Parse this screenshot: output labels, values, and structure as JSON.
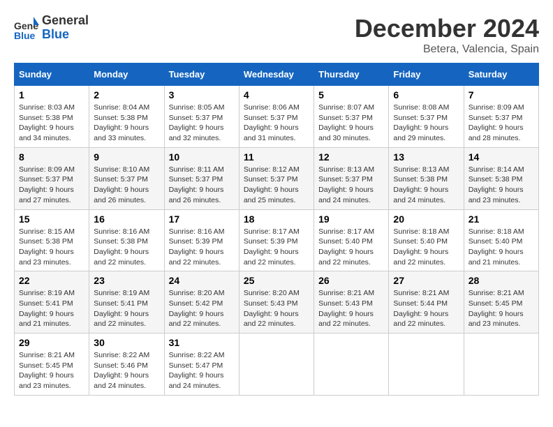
{
  "header": {
    "logo_line1": "General",
    "logo_line2": "Blue",
    "month_title": "December 2024",
    "location": "Betera, Valencia, Spain"
  },
  "weekdays": [
    "Sunday",
    "Monday",
    "Tuesday",
    "Wednesday",
    "Thursday",
    "Friday",
    "Saturday"
  ],
  "weeks": [
    [
      {
        "day": "1",
        "sunrise": "Sunrise: 8:03 AM",
        "sunset": "Sunset: 5:38 PM",
        "daylight": "Daylight: 9 hours and 34 minutes."
      },
      {
        "day": "2",
        "sunrise": "Sunrise: 8:04 AM",
        "sunset": "Sunset: 5:38 PM",
        "daylight": "Daylight: 9 hours and 33 minutes."
      },
      {
        "day": "3",
        "sunrise": "Sunrise: 8:05 AM",
        "sunset": "Sunset: 5:37 PM",
        "daylight": "Daylight: 9 hours and 32 minutes."
      },
      {
        "day": "4",
        "sunrise": "Sunrise: 8:06 AM",
        "sunset": "Sunset: 5:37 PM",
        "daylight": "Daylight: 9 hours and 31 minutes."
      },
      {
        "day": "5",
        "sunrise": "Sunrise: 8:07 AM",
        "sunset": "Sunset: 5:37 PM",
        "daylight": "Daylight: 9 hours and 30 minutes."
      },
      {
        "day": "6",
        "sunrise": "Sunrise: 8:08 AM",
        "sunset": "Sunset: 5:37 PM",
        "daylight": "Daylight: 9 hours and 29 minutes."
      },
      {
        "day": "7",
        "sunrise": "Sunrise: 8:09 AM",
        "sunset": "Sunset: 5:37 PM",
        "daylight": "Daylight: 9 hours and 28 minutes."
      }
    ],
    [
      {
        "day": "8",
        "sunrise": "Sunrise: 8:09 AM",
        "sunset": "Sunset: 5:37 PM",
        "daylight": "Daylight: 9 hours and 27 minutes."
      },
      {
        "day": "9",
        "sunrise": "Sunrise: 8:10 AM",
        "sunset": "Sunset: 5:37 PM",
        "daylight": "Daylight: 9 hours and 26 minutes."
      },
      {
        "day": "10",
        "sunrise": "Sunrise: 8:11 AM",
        "sunset": "Sunset: 5:37 PM",
        "daylight": "Daylight: 9 hours and 26 minutes."
      },
      {
        "day": "11",
        "sunrise": "Sunrise: 8:12 AM",
        "sunset": "Sunset: 5:37 PM",
        "daylight": "Daylight: 9 hours and 25 minutes."
      },
      {
        "day": "12",
        "sunrise": "Sunrise: 8:13 AM",
        "sunset": "Sunset: 5:37 PM",
        "daylight": "Daylight: 9 hours and 24 minutes."
      },
      {
        "day": "13",
        "sunrise": "Sunrise: 8:13 AM",
        "sunset": "Sunset: 5:38 PM",
        "daylight": "Daylight: 9 hours and 24 minutes."
      },
      {
        "day": "14",
        "sunrise": "Sunrise: 8:14 AM",
        "sunset": "Sunset: 5:38 PM",
        "daylight": "Daylight: 9 hours and 23 minutes."
      }
    ],
    [
      {
        "day": "15",
        "sunrise": "Sunrise: 8:15 AM",
        "sunset": "Sunset: 5:38 PM",
        "daylight": "Daylight: 9 hours and 23 minutes."
      },
      {
        "day": "16",
        "sunrise": "Sunrise: 8:16 AM",
        "sunset": "Sunset: 5:38 PM",
        "daylight": "Daylight: 9 hours and 22 minutes."
      },
      {
        "day": "17",
        "sunrise": "Sunrise: 8:16 AM",
        "sunset": "Sunset: 5:39 PM",
        "daylight": "Daylight: 9 hours and 22 minutes."
      },
      {
        "day": "18",
        "sunrise": "Sunrise: 8:17 AM",
        "sunset": "Sunset: 5:39 PM",
        "daylight": "Daylight: 9 hours and 22 minutes."
      },
      {
        "day": "19",
        "sunrise": "Sunrise: 8:17 AM",
        "sunset": "Sunset: 5:40 PM",
        "daylight": "Daylight: 9 hours and 22 minutes."
      },
      {
        "day": "20",
        "sunrise": "Sunrise: 8:18 AM",
        "sunset": "Sunset: 5:40 PM",
        "daylight": "Daylight: 9 hours and 22 minutes."
      },
      {
        "day": "21",
        "sunrise": "Sunrise: 8:18 AM",
        "sunset": "Sunset: 5:40 PM",
        "daylight": "Daylight: 9 hours and 21 minutes."
      }
    ],
    [
      {
        "day": "22",
        "sunrise": "Sunrise: 8:19 AM",
        "sunset": "Sunset: 5:41 PM",
        "daylight": "Daylight: 9 hours and 21 minutes."
      },
      {
        "day": "23",
        "sunrise": "Sunrise: 8:19 AM",
        "sunset": "Sunset: 5:41 PM",
        "daylight": "Daylight: 9 hours and 22 minutes."
      },
      {
        "day": "24",
        "sunrise": "Sunrise: 8:20 AM",
        "sunset": "Sunset: 5:42 PM",
        "daylight": "Daylight: 9 hours and 22 minutes."
      },
      {
        "day": "25",
        "sunrise": "Sunrise: 8:20 AM",
        "sunset": "Sunset: 5:43 PM",
        "daylight": "Daylight: 9 hours and 22 minutes."
      },
      {
        "day": "26",
        "sunrise": "Sunrise: 8:21 AM",
        "sunset": "Sunset: 5:43 PM",
        "daylight": "Daylight: 9 hours and 22 minutes."
      },
      {
        "day": "27",
        "sunrise": "Sunrise: 8:21 AM",
        "sunset": "Sunset: 5:44 PM",
        "daylight": "Daylight: 9 hours and 22 minutes."
      },
      {
        "day": "28",
        "sunrise": "Sunrise: 8:21 AM",
        "sunset": "Sunset: 5:45 PM",
        "daylight": "Daylight: 9 hours and 23 minutes."
      }
    ],
    [
      {
        "day": "29",
        "sunrise": "Sunrise: 8:21 AM",
        "sunset": "Sunset: 5:45 PM",
        "daylight": "Daylight: 9 hours and 23 minutes."
      },
      {
        "day": "30",
        "sunrise": "Sunrise: 8:22 AM",
        "sunset": "Sunset: 5:46 PM",
        "daylight": "Daylight: 9 hours and 24 minutes."
      },
      {
        "day": "31",
        "sunrise": "Sunrise: 8:22 AM",
        "sunset": "Sunset: 5:47 PM",
        "daylight": "Daylight: 9 hours and 24 minutes."
      },
      null,
      null,
      null,
      null
    ]
  ]
}
